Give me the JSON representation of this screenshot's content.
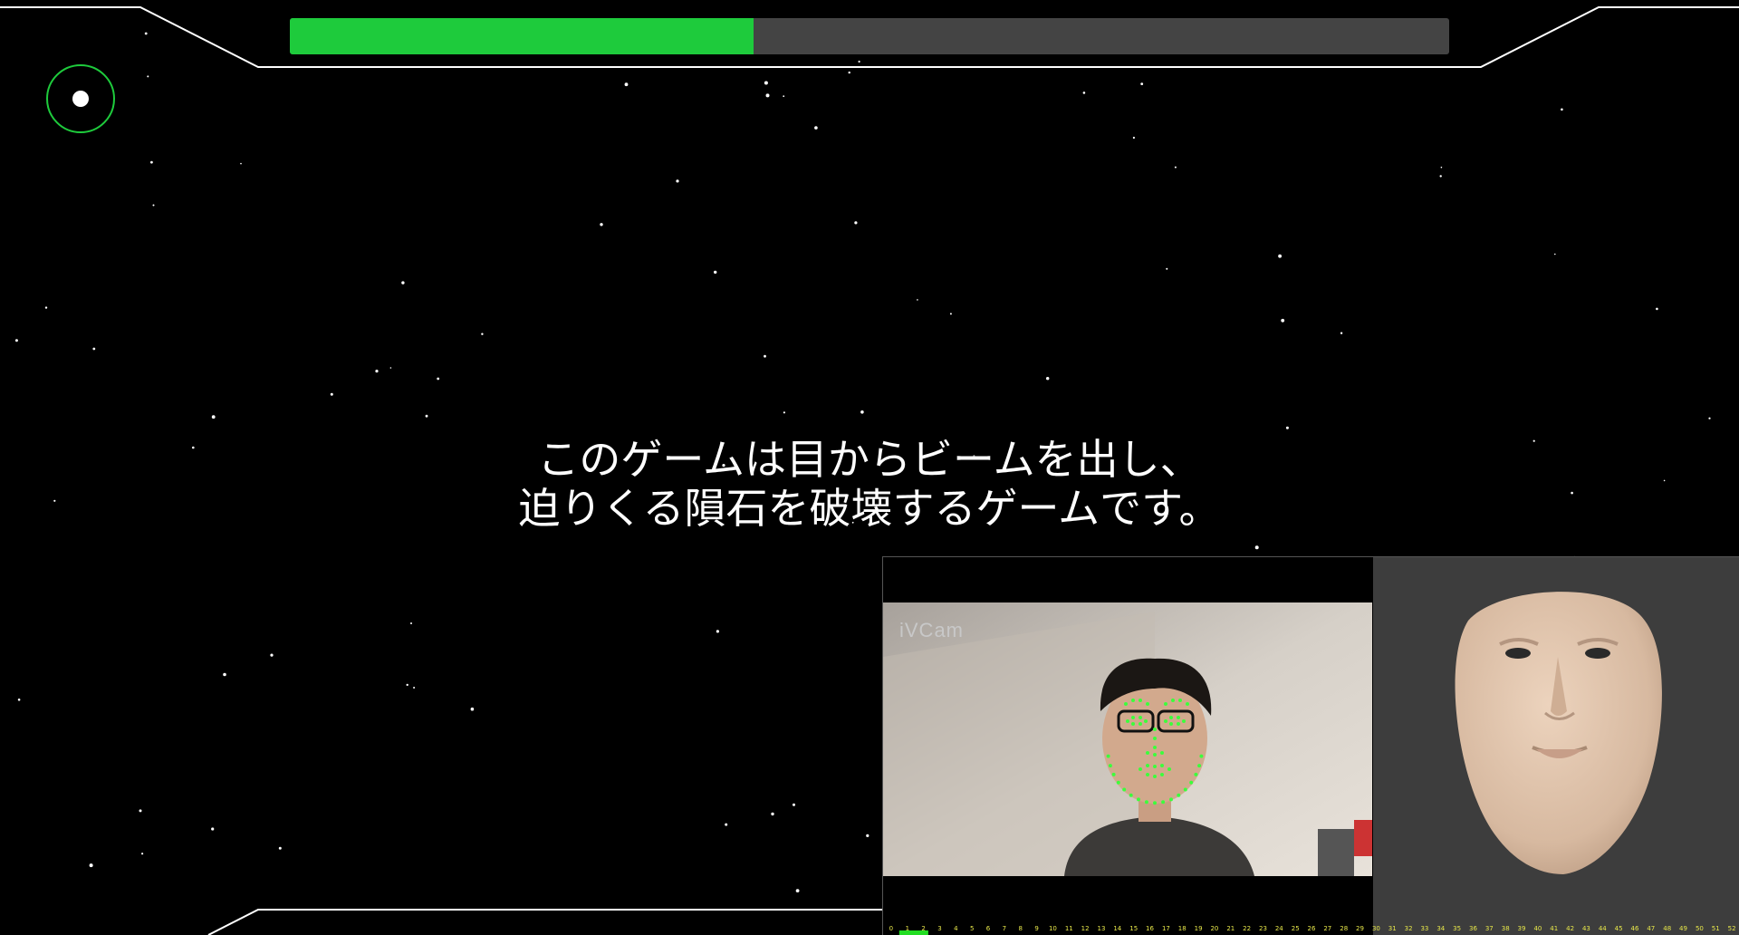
{
  "progress": {
    "fraction": 0.4,
    "fill_color": "#1ecb3c",
    "track_color": "#444444"
  },
  "reticle": {
    "icon": "gaze-target-icon",
    "color": "#1ecb3c"
  },
  "subtitle": {
    "line1": "このゲームは目からビームを出し、",
    "line2": "迫りくる隕石を破壊するゲームです。"
  },
  "camera": {
    "label": "iVCam",
    "landmark_color": "#3cff3c"
  },
  "avatar": {
    "icon": "face-avatar-icon",
    "skin_color": "#dcc0a8"
  },
  "frame_ruler": {
    "ticks": [
      "0",
      "1",
      "2",
      "3",
      "4",
      "5",
      "6",
      "7",
      "8",
      "9",
      "10",
      "11",
      "12",
      "13",
      "14",
      "15",
      "16",
      "17",
      "18",
      "19",
      "20",
      "21",
      "22",
      "23",
      "24",
      "25",
      "26",
      "27",
      "28",
      "29",
      "30",
      "31",
      "32",
      "33",
      "34",
      "35",
      "36",
      "37",
      "38",
      "39",
      "40",
      "41",
      "42",
      "43",
      "44",
      "45",
      "46",
      "47",
      "48",
      "49",
      "50",
      "51",
      "52"
    ],
    "current_frame": 1,
    "label_color": "#e8e84a",
    "marker_color": "#22dd22"
  }
}
